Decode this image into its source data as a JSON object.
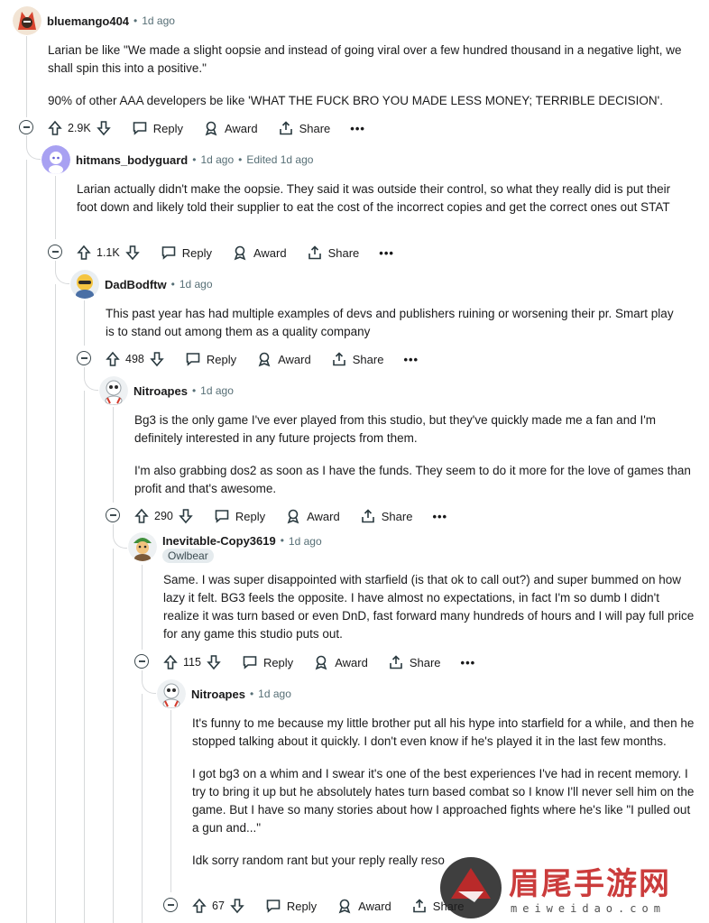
{
  "labels": {
    "reply": "Reply",
    "award": "Award",
    "share": "Share",
    "more": "•••",
    "sep": "•"
  },
  "comments": [
    {
      "username": "bluemango404",
      "time": "1d ago",
      "body": [
        "Larian be like \"We made a slight oopsie and instead of going viral over a few hundred thousand in a negative light, we shall spin this into a positive.\"",
        "90% of other AAA developers be like 'WHAT THE FUCK BRO YOU MADE LESS MONEY; TERRIBLE DECISION'."
      ],
      "votes": "2.9K"
    },
    {
      "username": "hitmans_bodyguard",
      "time": "1d ago",
      "edited": "Edited 1d ago",
      "body": [
        "Larian actually didn't make the oopsie. They said it was outside their control, so what they really did is put their foot down and likely told their supplier to eat the cost of the incorrect copies and get the correct ones out STAT"
      ],
      "votes": "1.1K"
    },
    {
      "username": "DadBodftw",
      "time": "1d ago",
      "body": [
        "This past year has had multiple examples of devs and publishers ruining or worsening their pr. Smart play is to stand out among them as a quality company"
      ],
      "votes": "498"
    },
    {
      "username": "Nitroapes",
      "time": "1d ago",
      "body": [
        "Bg3 is the only game I've ever played from this studio, but they've quickly made me a fan and I'm definitely interested in any future projects from them.",
        "I'm also grabbing dos2 as soon as I have the funds. They seem to do it more for the love of games than profit and that's awesome."
      ],
      "votes": "290"
    },
    {
      "username": "Inevitable-Copy3619",
      "time": "1d ago",
      "flair": "Owlbear",
      "body": [
        "Same. I was super disappointed with starfield (is that ok to call out?) and super bummed on how lazy it felt. BG3 feels the opposite. I have almost no expectations, in fact I'm so dumb I didn't realize it was turn based or even DnD, fast forward many hundreds of hours and I will pay full price for any game this studio puts out."
      ],
      "votes": "115"
    },
    {
      "username": "Nitroapes",
      "time": "1d ago",
      "body": [
        "It's funny to me because my little brother put all his hype into starfield for a while, and then he stopped talking about it quickly. I don't even know if he's played it in the last few months.",
        "I got bg3 on a whim and I swear it's one of the best experiences I've had in recent memory. I try to bring it up but he absolutely hates turn based combat so I know I'll never sell him on the game. But I have so many stories about how I approached fights where he's like \"I pulled out a gun and...\"",
        "Idk sorry random rant but your reply really reso"
      ],
      "votes": "67"
    }
  ],
  "watermark": {
    "text": "眉尾手游网",
    "url": "meiweidao.com"
  }
}
